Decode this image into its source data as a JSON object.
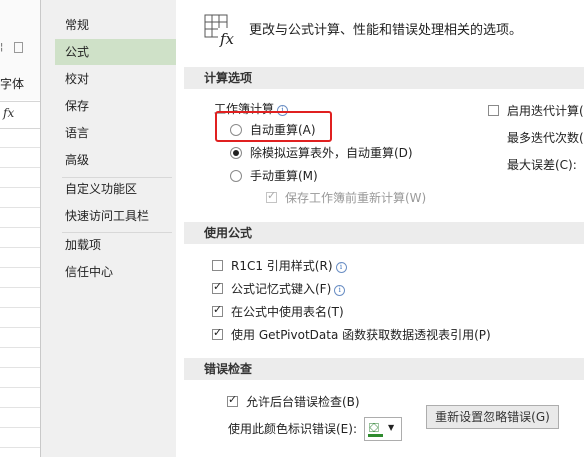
{
  "excel": {
    "font_group_label": "字体",
    "fx_label": "fx"
  },
  "nav": {
    "items": [
      {
        "label": "常规"
      },
      {
        "label": "公式",
        "active": true
      },
      {
        "label": "校对"
      },
      {
        "label": "保存"
      },
      {
        "label": "语言"
      },
      {
        "label": "高级"
      },
      {
        "label": "自定义功能区"
      },
      {
        "label": "快速访问工具栏"
      },
      {
        "label": "加载项"
      },
      {
        "label": "信任中心"
      }
    ]
  },
  "header": {
    "description": "更改与公式计算、性能和错误处理相关的选项。",
    "icon": "formula-fx-icon"
  },
  "calc_options": {
    "section_title": "计算选项",
    "workbook_calc_label": "工作簿计算",
    "auto": "自动重算(A)",
    "auto_except_tables": "除模拟运算表外，自动重算(D)",
    "manual": "手动重算(M)",
    "recalc_before_save": "保存工作簿前重新计算(W)",
    "enable_iterative": "启用迭代计算(",
    "max_iterations": "最多迭代次数(",
    "max_change": "最大误差(C):",
    "selected": "auto_except_tables"
  },
  "formulas": {
    "section_title": "使用公式",
    "r1c1": "R1C1 引用样式(R)",
    "autocomplete": "公式记忆式键入(F)",
    "table_names": "在公式中使用表名(T)",
    "getpivotdata": "使用 GetPivotData 函数获取数据透视表引用(P)"
  },
  "errors": {
    "section_title": "错误检查",
    "enable_background": "允许后台错误检查(B)",
    "indicate_color": "使用此颜色标识错误(E):",
    "reset_button": "重新设置忽略错误(G)"
  },
  "colors": {
    "active_nav": "#cfe1c8",
    "highlight_box": "#e02020",
    "section_bg": "#ececec",
    "error_color": "#2e8b2e"
  }
}
